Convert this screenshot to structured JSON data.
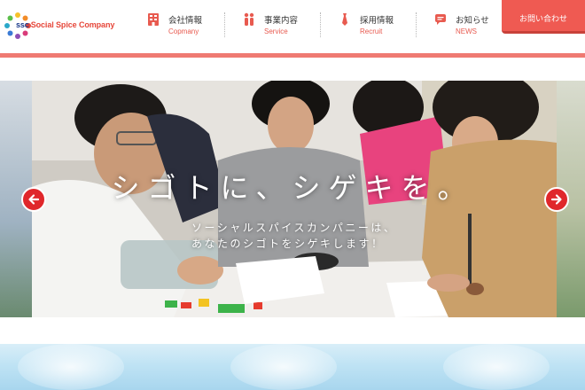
{
  "header": {
    "logo": {
      "mark": "ssc",
      "name": "Social Spice Company"
    },
    "nav": [
      {
        "label": "会社情報",
        "sublabel": "Copmany",
        "icon": "building-icon"
      },
      {
        "label": "事業内容",
        "sublabel": "Service",
        "icon": "people-icon"
      },
      {
        "label": "採用情報",
        "sublabel": "Recruit",
        "icon": "necktie-icon"
      },
      {
        "label": "お知らせ",
        "sublabel": "NEWS",
        "icon": "chat-bubble-icon"
      }
    ],
    "contact_label": "お問い合わせ"
  },
  "hero": {
    "title": "シゴトに、シゲキを。",
    "subtitle_line1": "ソーシャルスパイスカンパニーは、",
    "subtitle_line2": "あなたのシゴトをシゲキします！"
  },
  "colors": {
    "brand_red": "#ef5a52",
    "slider_arrow": "#e0272b",
    "nav_sub": "#e85a4f",
    "band_blue": "#bfe3f4"
  }
}
